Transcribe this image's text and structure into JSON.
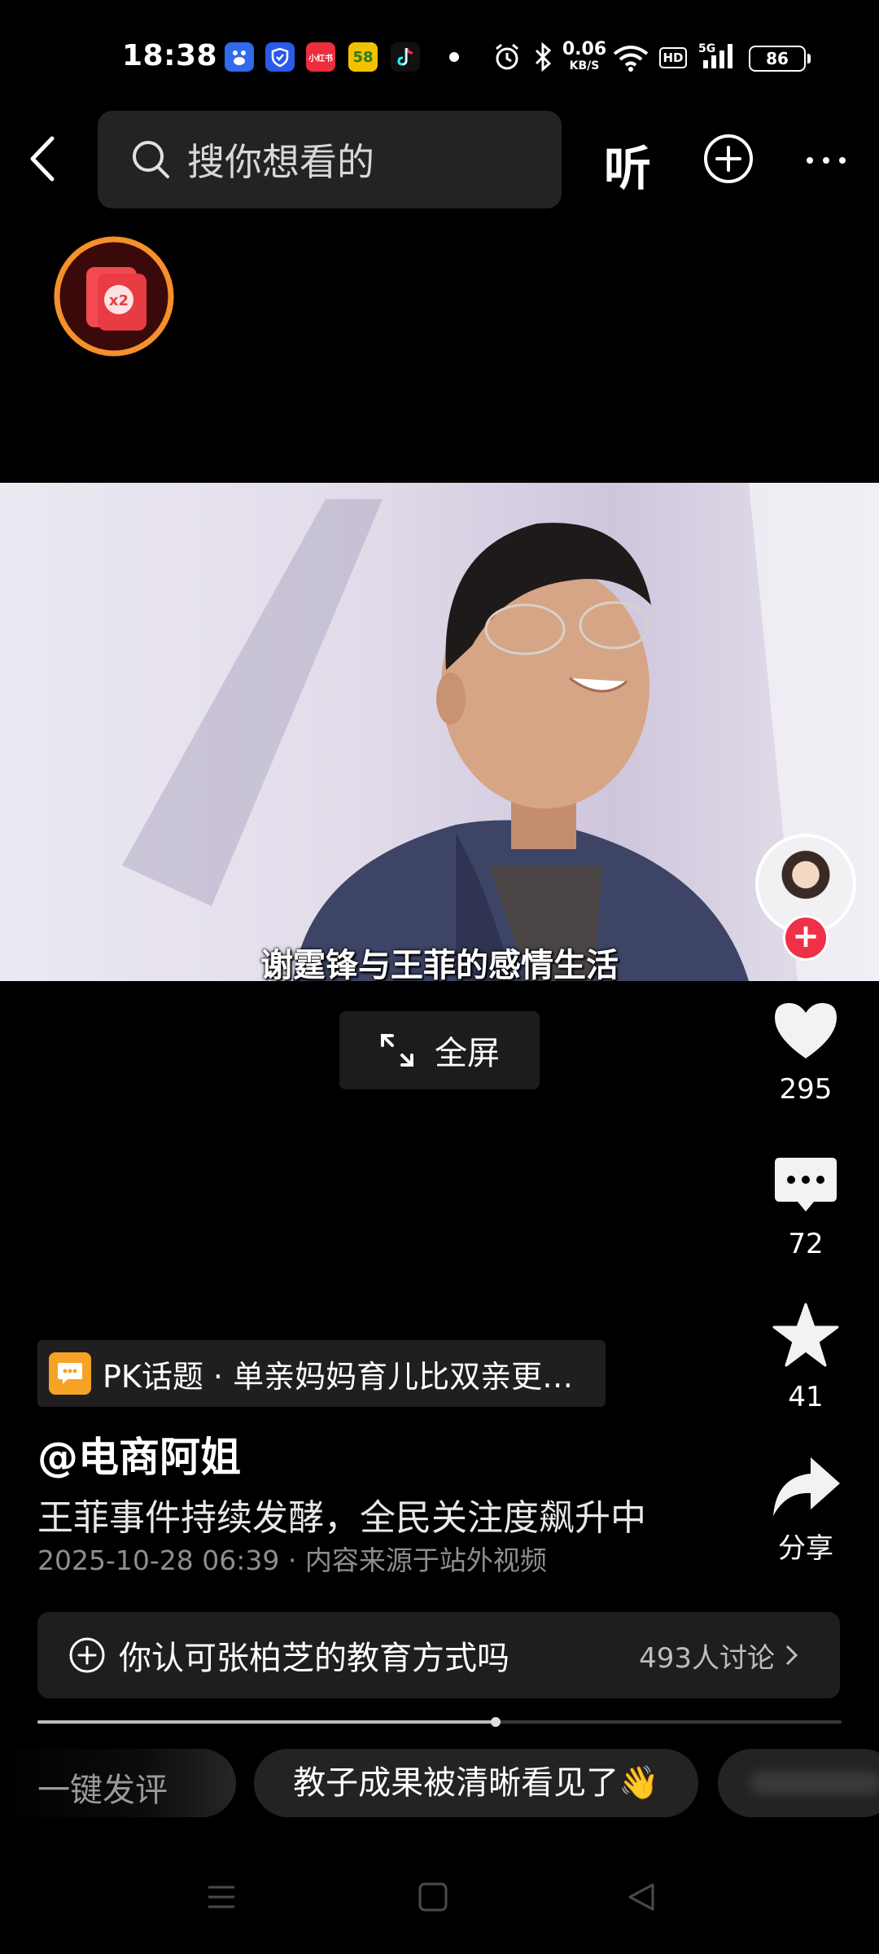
{
  "status_bar": {
    "time": "18:38",
    "app_icons": [
      {
        "name": "baidu-icon",
        "label": "du",
        "color": "#2f6bea"
      },
      {
        "name": "shield-app-icon",
        "label": "",
        "color": "#2a5ae8"
      },
      {
        "name": "xiaohongshu-icon",
        "label": "小红书",
        "color": "#ec2d3c"
      },
      {
        "name": "58-icon",
        "label": "58",
        "color": "#f2c200"
      },
      {
        "name": "tiktok-icon",
        "label": "",
        "color": "#111111"
      }
    ],
    "net_speed_value": "0.06",
    "net_speed_unit": "KB/S",
    "hd": "HD",
    "network": "5G",
    "battery": "86"
  },
  "nav": {
    "search_placeholder": "搜你想看的",
    "listen_label": "听"
  },
  "video": {
    "subtitle": "谢霆锋与王菲的感情生活"
  },
  "fullscreen_label": "全屏",
  "actions": {
    "like_count": "295",
    "comment_count": "72",
    "favorite_count": "41",
    "share_label": "分享"
  },
  "post": {
    "topic": "PK话题 · 单亲妈妈育儿比双亲更…",
    "author": "@电商阿姐",
    "title": "王菲事件持续发酵，全民关注度飙升中",
    "meta": "2025-10-28 06:39 · 内容来源于站外视频"
  },
  "discussion": {
    "text": "你认可张柏芝的教育方式吗",
    "count": "493人讨论"
  },
  "progress": 0.57,
  "comments": {
    "quick_label": "一键发评",
    "chip_1": "教子成果被清晰看见了👋"
  },
  "colors": {
    "accent_red": "#f03046",
    "timer_orange": "#f5902a"
  }
}
